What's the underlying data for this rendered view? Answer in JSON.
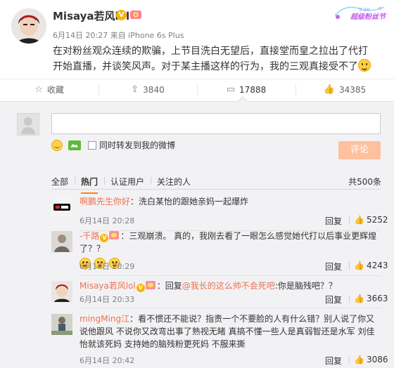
{
  "post": {
    "author": "Misaya若风lol",
    "verified_badge": "V",
    "meta": "6月14日 20:27 来自 iPhone 6s Plus",
    "text": "在对粉丝观众连续的欺骗，上节目洗白无望后，直接堂而皇之拉出了代打开始直播，并谈笑风声。对于某主播这样的行为，我的三观真接受不了",
    "festival_text": "超级粉丝节"
  },
  "actions": {
    "favorite": {
      "icon": "star-icon",
      "label": "收藏"
    },
    "repost": {
      "icon": "repost-icon",
      "label": "3840"
    },
    "comment": {
      "icon": "comment-icon",
      "label": "17888"
    },
    "like": {
      "icon": "thumb-up-icon",
      "label": "34385"
    }
  },
  "composer": {
    "forward_label": "同时转发到我的微博",
    "submit_label": "评论"
  },
  "tabs": {
    "items": [
      "全部",
      "热门",
      "认证用户",
      "关注的人"
    ],
    "active": "热门",
    "total": "共500条"
  },
  "comments": [
    {
      "name": "啊鹏先生你好",
      "text": "：洗白某怡的跟她亲妈一起爆炸",
      "time": "6月14日 20:28",
      "reply": "回复",
      "likes": "5252"
    },
    {
      "name": "-千路",
      "text": "：三观崩溃。 真的，我刚去看了一眼怎么感觉她代打以后事业更辉煌了？？",
      "time": "6月14日 20:29",
      "reply": "回复",
      "likes": "4243"
    },
    {
      "name": "Misaya若风lol",
      "text_prefix": "：回复",
      "mention": "@我长的这么帅不会死吧",
      "text_suffix": ":你是脑残吧？？",
      "time": "6月14日 20:33",
      "reply": "回复",
      "likes": "3663"
    },
    {
      "name": "mingMing江",
      "text": "：看不惯还不能说？指责一个不要脸的人有什么错？别人说了你又说他跟风 不说你又改弯出事了熟视无睹  真搞不懂一些人是真弱智还是水军 刘佳怡就该死妈  支持她的脑残粉更死妈  不服来撕",
      "time": "6月14日 20:42",
      "reply": "回复",
      "likes": "3086"
    }
  ]
}
